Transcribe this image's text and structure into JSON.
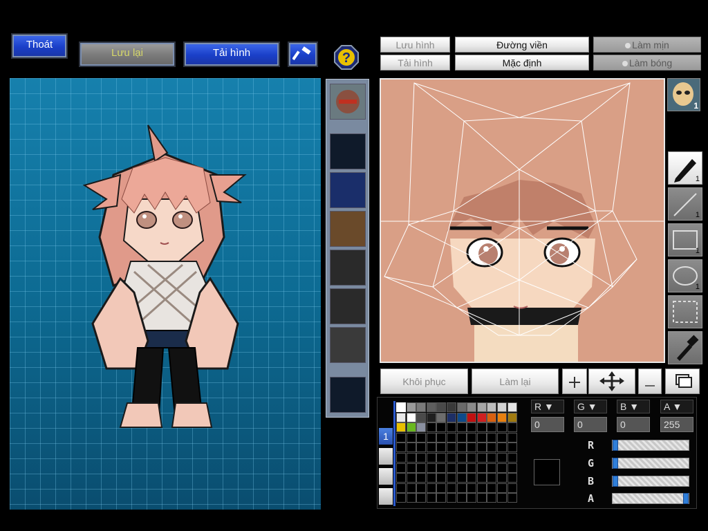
{
  "toolbar": {
    "exit_label": "Thoát",
    "save_label": "Lưu lại",
    "load_label": "Tải hình",
    "hammer_icon": "hammer-icon",
    "help_icon": "help-icon"
  },
  "editor_toolbar": {
    "save_image_label": "Lưu hình",
    "load_image_label": "Tải hình",
    "outline_label": "Đường viền",
    "default_label": "Mặc định",
    "smooth_label": "Làm mịn",
    "gloss_label": "Làm bóng"
  },
  "layer_badge": "1",
  "tools": [
    {
      "name": "pen-tool",
      "count": "1"
    },
    {
      "name": "line-tool",
      "count": "1"
    },
    {
      "name": "rectangle-tool",
      "count": "1"
    },
    {
      "name": "ellipse-tool",
      "count": "1"
    },
    {
      "name": "selection-tool",
      "count": ""
    },
    {
      "name": "eyedropper-tool",
      "count": ""
    }
  ],
  "actions": {
    "restore_label": "Khôi phục",
    "redo_label": "Làm lại",
    "plus_icon": "plus-icon",
    "move_icon": "move-arrows-icon",
    "minus_icon": "minus-icon",
    "layers_icon": "layers-icon"
  },
  "palette": {
    "tab_label": "1",
    "row1": [
      "#ffffff",
      "#9a9a9a",
      "#7a7a7a",
      "#5e5e5e",
      "#4a4a4a",
      "#3a3a3a",
      "#6a6a6a",
      "#8a8a8a",
      "#a6a6a6",
      "#bdbdbd",
      "#d2d2d2",
      "#e4e4e4"
    ],
    "row2": [
      "#e8e8e8",
      "#ffffff",
      "#4a4a4a",
      "#202020",
      "#6d6d6d",
      "#1d2f66",
      "#0d4a8a",
      "#c01010",
      "#d02020",
      "#d86010",
      "#e88010",
      "#a07a10"
    ],
    "row3": [
      "#e8c000",
      "#6ab820",
      "#8a90a0"
    ]
  },
  "channels": {
    "r": {
      "label": "R",
      "value": "0",
      "level": 0.0
    },
    "g": {
      "label": "G",
      "value": "0",
      "level": 0.0
    },
    "b": {
      "label": "B",
      "value": "0",
      "level": 0.0
    },
    "a": {
      "label": "A",
      "value": "255",
      "level": 1.0
    }
  }
}
